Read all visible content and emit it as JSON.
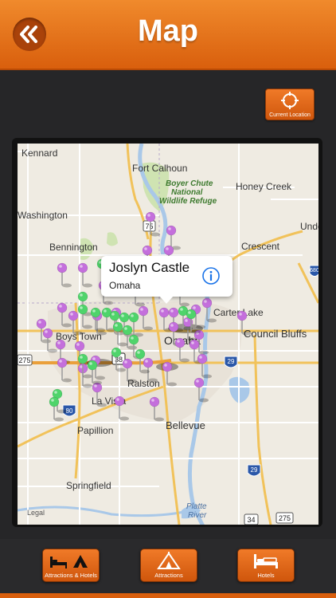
{
  "header": {
    "title": "Map"
  },
  "location_button": {
    "label": "Current Location"
  },
  "callout": {
    "title": "Joslyn Castle",
    "subtitle": "Omaha"
  },
  "map_labels": {
    "kennard": "Kennard",
    "fort_calhoun": "Fort Calhoun",
    "boyer_chute": "Boyer Chute",
    "national": "National",
    "wildlife_refuge": "Wildlife Refuge",
    "honey_creek": "Honey Creek",
    "washington": "Washington",
    "undo": "Undo",
    "bennington": "Bennington",
    "crescent": "Crescent",
    "boys_town": "Boys Town",
    "omaha": "Omaha",
    "carter_lake": "Carter Lake",
    "council_bluffs": "Council Bluffs",
    "ralston": "Ralston",
    "la_vista": "La Vista",
    "bellevue": "Bellevue",
    "papillion": "Papillion",
    "springfield": "Springfield",
    "platte": "Platte",
    "river": "River",
    "legal": "Legal"
  },
  "highway_shields": {
    "h75": "75",
    "h680": "680",
    "h275a": "275",
    "h38": "38",
    "h29": "29",
    "h80": "80",
    "h29b": "29",
    "h275b": "275",
    "h34": "34"
  },
  "tabs": [
    {
      "label": "Attractions & Hotels",
      "icon": "bed-and-tent-icon"
    },
    {
      "label": "Attractions",
      "icon": "tent-icon"
    },
    {
      "label": "Hotels",
      "icon": "bed-icon"
    }
  ],
  "pin_colors": {
    "attraction": "#c46fdc",
    "hotel": "#4fd46b"
  }
}
